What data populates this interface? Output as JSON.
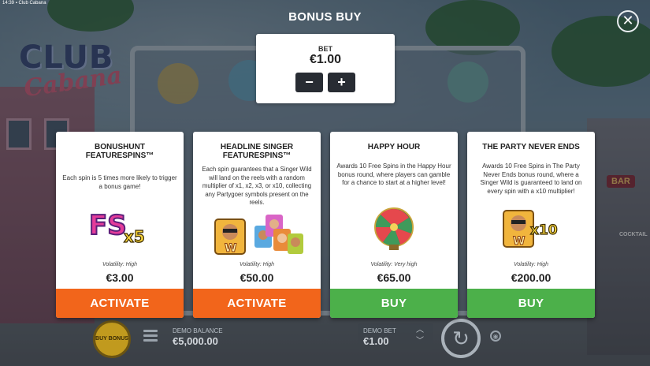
{
  "status_bar": {
    "time": "14:39",
    "app_name": "Club Cabana"
  },
  "background": {
    "logo_line1": "CLUB",
    "logo_line2": "Cabana",
    "bar_sign": "BAR",
    "cocktail_sign": "COCKTAIL"
  },
  "header": {
    "title": "BONUS BUY",
    "close_icon": "close-icon"
  },
  "bet_panel": {
    "label": "BET",
    "value": "€1.00",
    "decrease_label": "−",
    "increase_label": "+"
  },
  "cards": [
    {
      "title": "BONUSHUNT FEATURESPINS™",
      "description": "Each spin is 5 times more likely to trigger a bonus game!",
      "art_text": "FS",
      "art_multiplier": "x5",
      "volatility": "Volatility: High",
      "price": "€3.00",
      "button_label": "ACTIVATE",
      "button_color": "#f2651b"
    },
    {
      "title": "HEADLINE SINGER FEATURESPINS™",
      "description": "Each spin guarantees that a Singer Wild will land on the reels with a random multiplier of x1, x2, x3, or x10, collecting any Partygoer symbols present on the reels.",
      "art_text": "W",
      "volatility": "Volatility: High",
      "price": "€50.00",
      "button_label": "ACTIVATE",
      "button_color": "#f2651b"
    },
    {
      "title": "HAPPY HOUR",
      "description": "Awards 10 Free Spins in the Happy Hour bonus round, where players can gamble for a chance to start at a higher level!",
      "volatility": "Volatility: Very high",
      "price": "€65.00",
      "button_label": "BUY",
      "button_color": "#4cb04a"
    },
    {
      "title": "THE PARTY NEVER ENDS",
      "description": "Awards 10 Free Spins in The Party Never Ends bonus round, where a Singer Wild is guaranteed to land on every spin with a x10 multiplier!",
      "art_text": "W",
      "art_multiplier": "x10",
      "volatility": "Volatility: High",
      "price": "€200.00",
      "button_label": "BUY",
      "button_color": "#4cb04a"
    }
  ],
  "bottom_bar": {
    "buy_bonus_label": "BUY BONUS",
    "demo_balance_label": "DEMO BALANCE",
    "demo_balance_value": "€5,000.00",
    "demo_bet_label": "DEMO BET",
    "demo_bet_value": "€1.00",
    "bet_up_icon": "chevron-up-icon",
    "bet_down_icon": "chevron-down-icon",
    "spin_icon": "spin-icon",
    "autoplay_icon": "autoplay-icon",
    "menu_icon": "menu-icon"
  }
}
